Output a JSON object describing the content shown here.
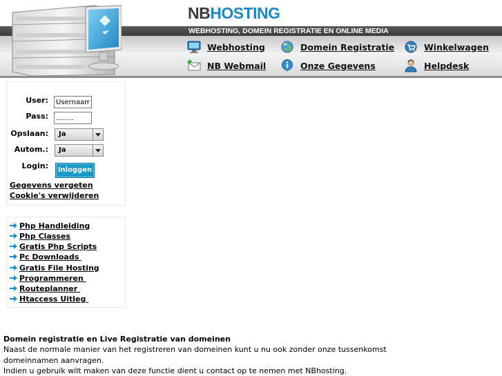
{
  "header": {
    "logo_nb": "NB",
    "logo_hosting": "HOSTING",
    "tagline": "WEBHOSTING, DOMEIN REGISTRATIE EN ONLINE MEDIA",
    "nav": [
      {
        "label": "Webhosting",
        "icon": "monitor-icon"
      },
      {
        "label": "Domein Registratie",
        "icon": "globe-icon"
      },
      {
        "label": "Winkelwagen",
        "icon": "cart-icon"
      },
      {
        "label": "NB Webmail",
        "icon": "mail-icon"
      },
      {
        "label": "Onze Gegevens",
        "icon": "info-icon"
      },
      {
        "label": "Helpdesk",
        "icon": "support-person-icon"
      }
    ]
  },
  "login": {
    "user_label": "User:",
    "user_value": "Usernaam",
    "pass_label": "Pass:",
    "pass_value": "........",
    "opslaan_label": "Opslaan:",
    "opslaan_value": "Ja",
    "autom_label": "Autom.:",
    "autom_value": "Ja",
    "login_label": "Login:",
    "login_button": "Inloggen",
    "forgot_link": "Gegevens vergeten",
    "cookie_link": "Cookie's verwijderen"
  },
  "links": [
    "Php Handleiding",
    "Php Classes",
    "Gratis Php Scripts",
    "Pc Downloads ",
    "Gratis File Hosting",
    "Programmeren ",
    "Routeplanner ",
    "Htaccess Uitleg "
  ],
  "content": {
    "heading": "Domein registratie en Live Registratie van domeinen",
    "line1": "Naast de normale manier van het registreren van domeinen kunt u nu ook zonder onze tussenkomst",
    "line2": "domeinnamen aanvragen.",
    "line3": "Indien u gebruik wilt maken van deze functie dient u contact op te nemen met NBhosting."
  },
  "colors": {
    "accent": "#1e87c8",
    "button": "#1a9ac7",
    "arrow": "#1a8fd0"
  }
}
